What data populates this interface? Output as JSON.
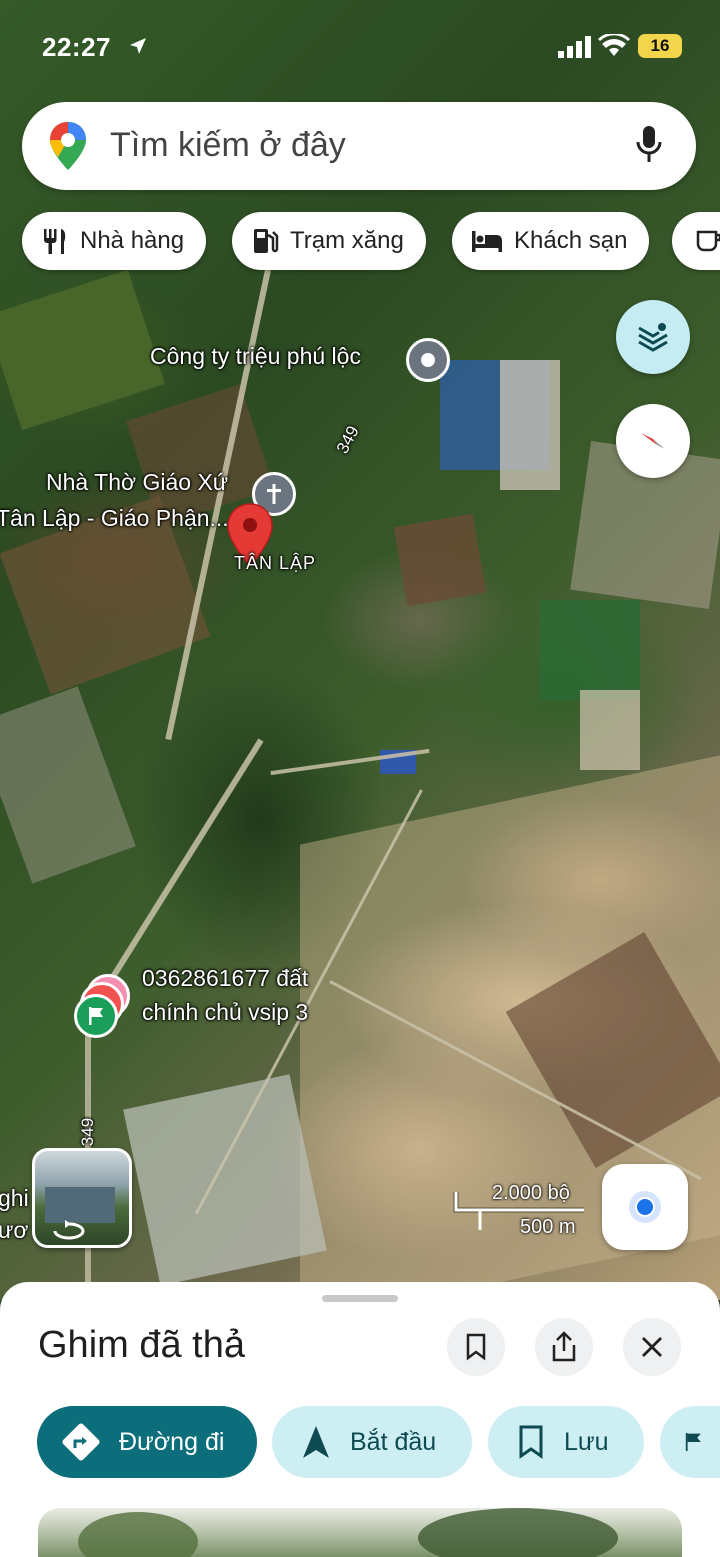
{
  "status_bar": {
    "time": "22:27",
    "battery": "16"
  },
  "search": {
    "placeholder": "Tìm kiếm ở đây",
    "icon": "maps-pin-icon",
    "mic_icon": "microphone-icon"
  },
  "chips": [
    {
      "label": "Nhà hàng",
      "icon": "restaurant-icon"
    },
    {
      "label": "Trạm xăng",
      "icon": "gas-station-icon"
    },
    {
      "label": "Khách sạn",
      "icon": "hotel-icon"
    },
    {
      "label": "",
      "icon": "coffee-icon"
    }
  ],
  "map": {
    "places": [
      {
        "name": "Công ty triệu phú lộc"
      },
      {
        "name": "Nhà Thờ Giáo Xứ",
        "name2": "Tân Lập - Giáo Phận..."
      },
      {
        "name": "TÂN LẬP"
      },
      {
        "name": "0362861677 đất",
        "name2": "chính chủ vsip 3"
      }
    ],
    "road_labels": [
      "349",
      "349"
    ],
    "edge_labels": [
      "ghi",
      "ươ"
    ],
    "scale": {
      "imperial": "2.000 bộ",
      "metric": "500 m"
    }
  },
  "sheet": {
    "title": "Ghim đã thả",
    "actions": [
      {
        "label": "Đường đi",
        "icon": "directions-icon"
      },
      {
        "label": "Bắt đầu",
        "icon": "navigation-arrow-icon"
      },
      {
        "label": "Lưu",
        "icon": "bookmark-icon"
      },
      {
        "label": "",
        "icon": "flag-icon"
      }
    ]
  },
  "colors": {
    "primary": "#0b6e7a",
    "secondary": "#cdeef3",
    "pin_red": "#e53935"
  }
}
